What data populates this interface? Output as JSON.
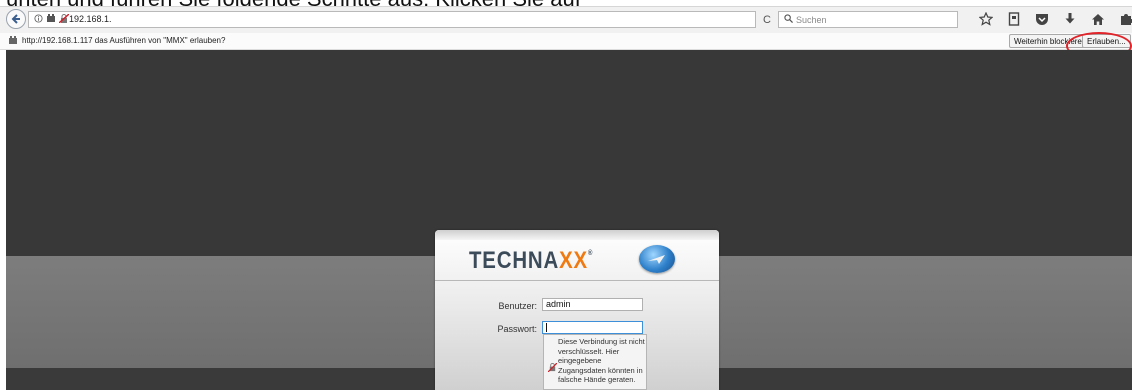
{
  "caption": "unten und führen Sie folgende Schritte aus: Klicken Sie auf",
  "browser": {
    "url": "192.168.1.",
    "search_placeholder": "Suchen",
    "reload_glyph": "C"
  },
  "notification": {
    "text": "http://192.168.1.117 das Ausführen von \"MMX\" erlauben?",
    "block_button": "Weiterhin blockieren",
    "allow_button": "Erlauben..."
  },
  "login": {
    "brand_main": "TECHNA",
    "brand_accent": "XX",
    "brand_mark": "®",
    "user_label": "Benutzer:",
    "user_value": "admin",
    "pass_label": "Passwort:",
    "pass_value": "",
    "tooltip": "Diese Verbindung ist nicht verschlüsselt. Hier eingegebene Zugangsdaten könnten in falsche Hände geraten."
  },
  "colors": {
    "accent_orange": "#f07a12",
    "highlight_red": "#e0242a",
    "page_dark": "#383838",
    "page_band": "#777777"
  }
}
